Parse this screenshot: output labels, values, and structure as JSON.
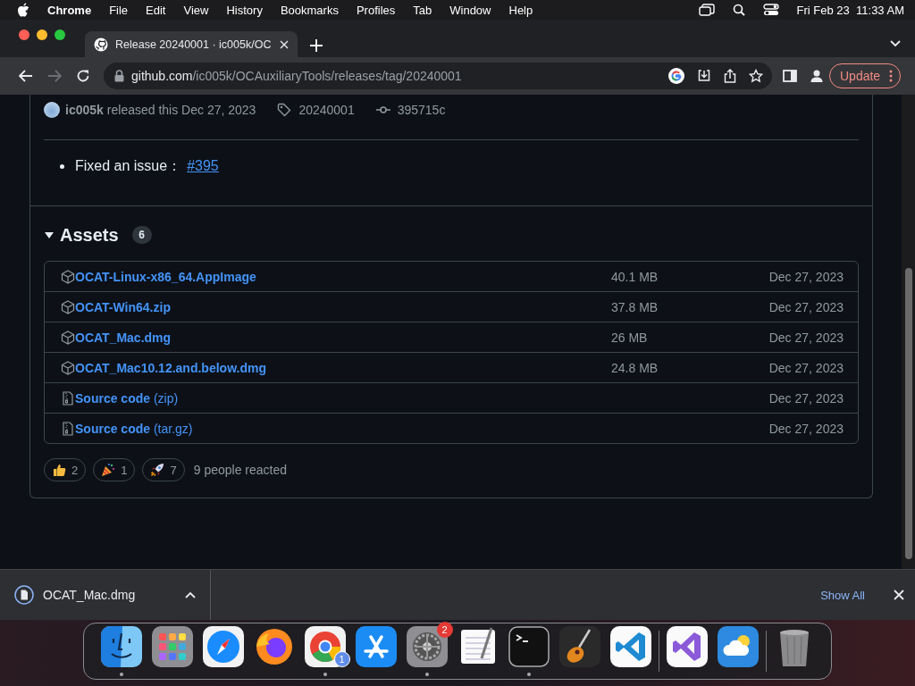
{
  "menubar": {
    "app": "Chrome",
    "menus": [
      "File",
      "Edit",
      "View",
      "History",
      "Bookmarks",
      "Profiles",
      "Tab",
      "Window",
      "Help"
    ],
    "clock": "Fri Feb 23  11:33 AM"
  },
  "browser": {
    "tabs": [
      {
        "title": "Release 20240001 · ic005k/OC",
        "selected": true
      }
    ],
    "url": {
      "host": "github.com",
      "path": "/ic005k/OCAuxiliaryTools/releases/tag/20240001"
    },
    "forward_disabled": true,
    "update_button": "Update"
  },
  "release": {
    "author": "ic005k",
    "released_text": "released this Dec 27, 2023",
    "tag": "20240001",
    "commit": "395715c",
    "notes": [
      {
        "text": "Fixed an issue：",
        "link": "#395"
      }
    ],
    "assets": {
      "title": "Assets",
      "count": "6",
      "expanded": true,
      "rows": [
        {
          "kind": "package",
          "name": "OCAT-Linux-x86_64.AppImage",
          "size": "40.1 MB",
          "date": "Dec 27, 2023"
        },
        {
          "kind": "package",
          "name": "OCAT-Win64.zip",
          "size": "37.8 MB",
          "date": "Dec 27, 2023"
        },
        {
          "kind": "package",
          "name": "OCAT_Mac.dmg",
          "size": "26 MB",
          "date": "Dec 27, 2023"
        },
        {
          "kind": "package",
          "name": "OCAT_Mac10.12.and.below.dmg",
          "size": "24.8 MB",
          "date": "Dec 27, 2023"
        },
        {
          "kind": "source",
          "name": "Source code",
          "format": "(zip)",
          "date": "Dec 27, 2023"
        },
        {
          "kind": "source",
          "name": "Source code",
          "format": "(tar.gz)",
          "date": "Dec 27, 2023"
        }
      ]
    },
    "reactions": [
      {
        "kind": "thumbs-up",
        "count": "2"
      },
      {
        "kind": "party",
        "count": "1"
      },
      {
        "kind": "rocket",
        "count": "7"
      }
    ],
    "reactions_summary": "9 people reacted"
  },
  "download_bar": {
    "items": [
      {
        "filename": "OCAT_Mac.dmg"
      }
    ],
    "show_all": "Show All"
  },
  "dock": {
    "sections": [
      {
        "apps": [
          {
            "kind": "finder",
            "running": true
          },
          {
            "kind": "launchpad",
            "running": false
          },
          {
            "kind": "safari",
            "running": false
          },
          {
            "kind": "firefox",
            "running": false
          },
          {
            "kind": "chrome",
            "running": true,
            "badge": "1"
          },
          {
            "kind": "appstore",
            "running": false
          },
          {
            "kind": "settings",
            "running": true,
            "badge": "2"
          },
          {
            "kind": "textedit",
            "running": false
          },
          {
            "kind": "terminal",
            "running": true
          },
          {
            "kind": "garageband",
            "running": false
          },
          {
            "kind": "vscode",
            "running": false
          }
        ]
      },
      {
        "apps": [
          {
            "kind": "visualstudio",
            "running": false
          },
          {
            "kind": "weather",
            "running": false
          }
        ]
      },
      {
        "apps": [
          {
            "kind": "trash",
            "running": false
          }
        ]
      }
    ]
  }
}
